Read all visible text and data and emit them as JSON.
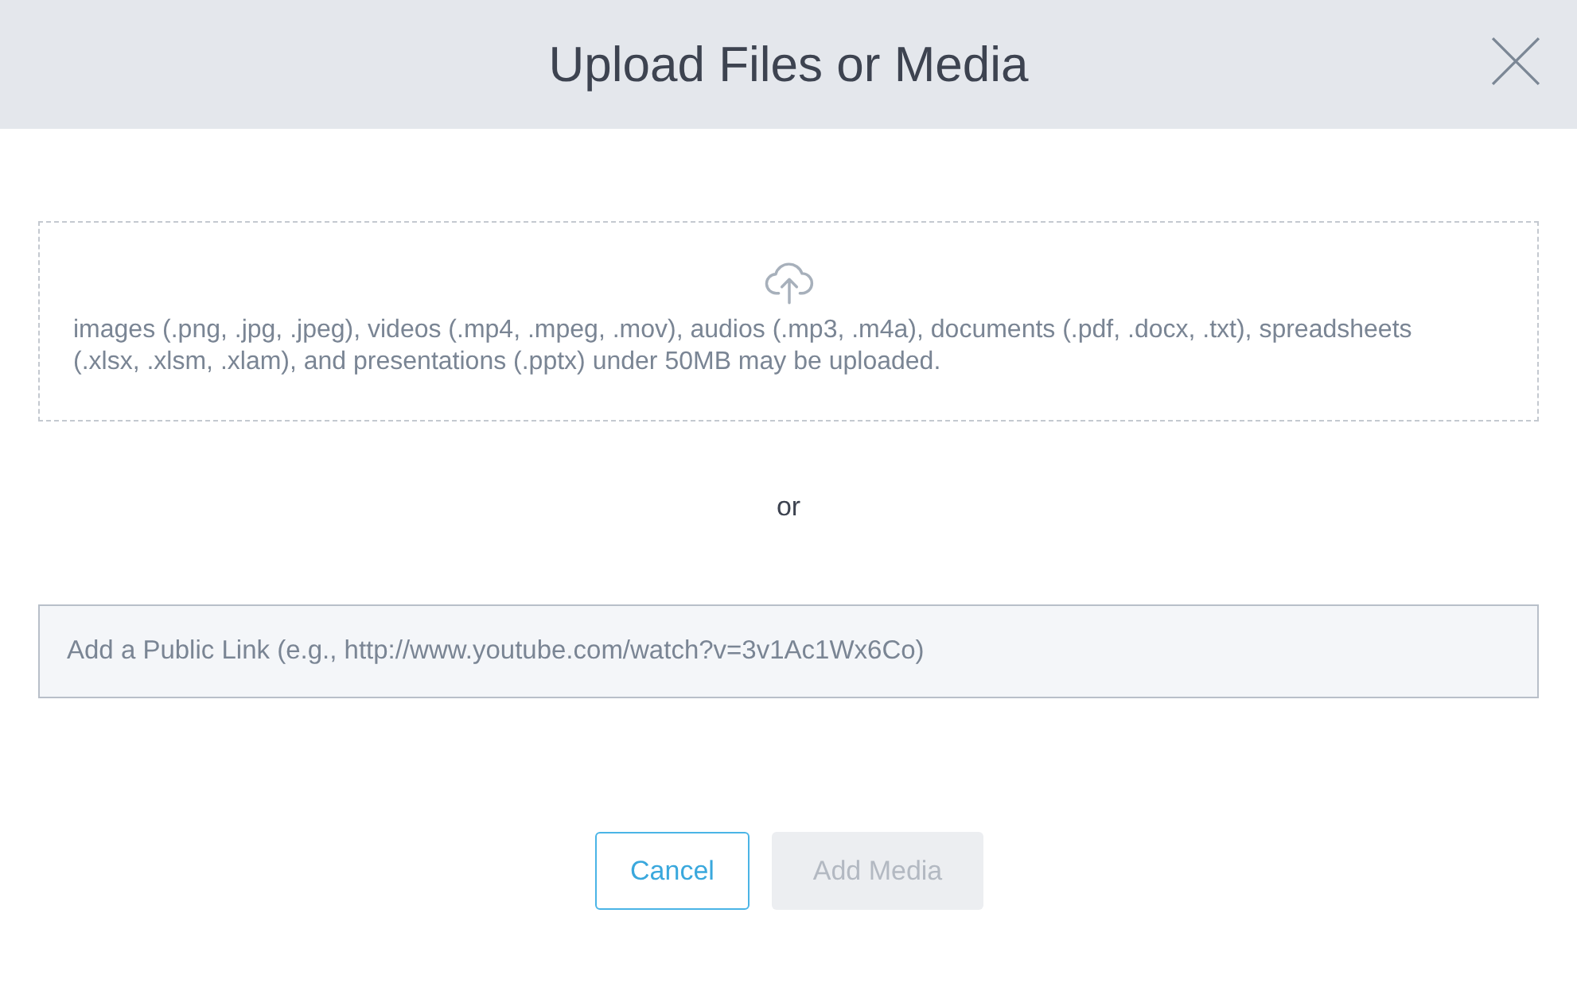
{
  "dialog": {
    "title": "Upload Files or Media"
  },
  "dropzone": {
    "description": "images (.png, .jpg, .jpeg), videos (.mp4, .mpeg, .mov), audios (.mp3, .m4a), documents (.pdf, .docx, .txt), spreadsheets (.xlsx, .xlsm, .xlam), and presentations (.pptx) under 50MB may be uploaded."
  },
  "separator": "or",
  "link_field": {
    "placeholder": "Add a Public Link (e.g., http://www.youtube.com/watch?v=3v1Ac1Wx6Co)"
  },
  "buttons": [
    {
      "label": "Cancel",
      "kind": "secondary",
      "disabled": false
    },
    {
      "label": "Add Media",
      "kind": "primary",
      "disabled": true
    }
  ]
}
